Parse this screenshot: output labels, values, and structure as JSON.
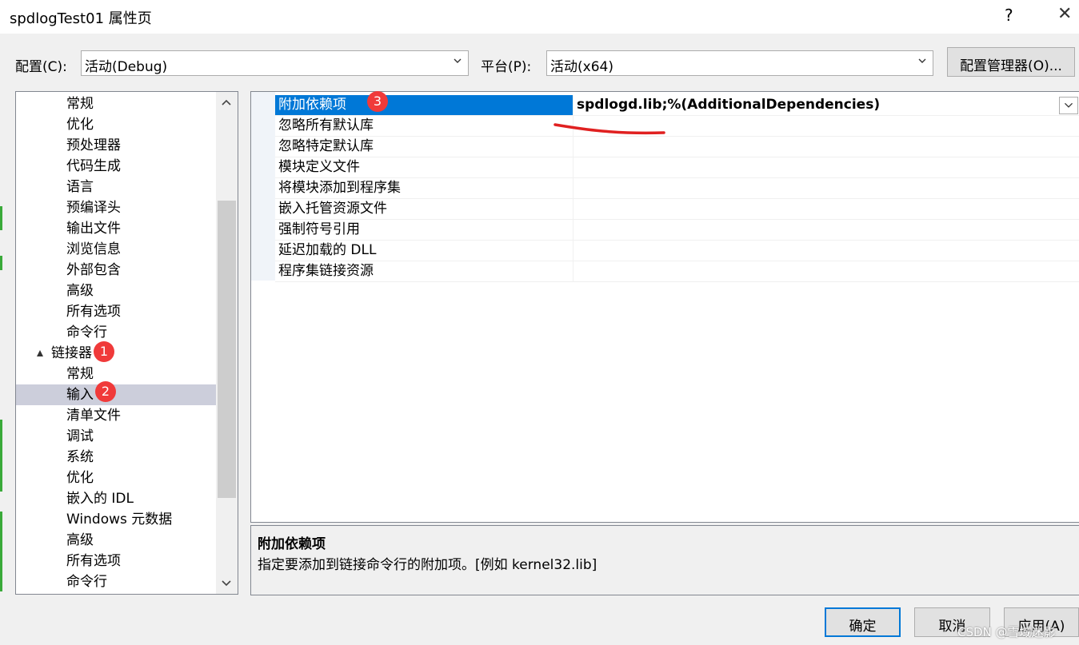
{
  "window": {
    "title": "spdlogTest01 属性页",
    "help_glyph": "?",
    "close_glyph": "✕"
  },
  "toolbar": {
    "config_label": "配置(C):",
    "config_value": "活动(Debug)",
    "platform_label": "平台(P):",
    "platform_value": "活动(x64)",
    "config_manager_label": "配置管理器(O)..."
  },
  "tree": {
    "items": [
      {
        "label": "常规",
        "level": 2
      },
      {
        "label": "优化",
        "level": 2
      },
      {
        "label": "预处理器",
        "level": 2
      },
      {
        "label": "代码生成",
        "level": 2
      },
      {
        "label": "语言",
        "level": 2
      },
      {
        "label": "预编译头",
        "level": 2
      },
      {
        "label": "输出文件",
        "level": 2
      },
      {
        "label": "浏览信息",
        "level": 2
      },
      {
        "label": "外部包含",
        "level": 2
      },
      {
        "label": "高级",
        "level": 2
      },
      {
        "label": "所有选项",
        "level": 2
      },
      {
        "label": "命令行",
        "level": 2
      },
      {
        "label": "链接器",
        "level": 1,
        "expanded": true
      },
      {
        "label": "常规",
        "level": 2
      },
      {
        "label": "输入",
        "level": 2,
        "selected": true
      },
      {
        "label": "清单文件",
        "level": 2
      },
      {
        "label": "调试",
        "level": 2
      },
      {
        "label": "系统",
        "level": 2
      },
      {
        "label": "优化",
        "level": 2
      },
      {
        "label": "嵌入的 IDL",
        "level": 2
      },
      {
        "label": "Windows 元数据",
        "level": 2
      },
      {
        "label": "高级",
        "level": 2
      },
      {
        "label": "所有选项",
        "level": 2
      },
      {
        "label": "命令行",
        "level": 2
      }
    ]
  },
  "properties": {
    "rows": [
      {
        "name": "附加依赖项",
        "value": "spdlogd.lib;%(AdditionalDependencies)",
        "selected": true
      },
      {
        "name": "忽略所有默认库",
        "value": ""
      },
      {
        "name": "忽略特定默认库",
        "value": ""
      },
      {
        "name": "模块定义文件",
        "value": ""
      },
      {
        "name": "将模块添加到程序集",
        "value": ""
      },
      {
        "name": "嵌入托管资源文件",
        "value": ""
      },
      {
        "name": "强制符号引用",
        "value": ""
      },
      {
        "name": "延迟加载的 DLL",
        "value": ""
      },
      {
        "name": "程序集链接资源",
        "value": ""
      }
    ]
  },
  "description": {
    "title": "附加依赖项",
    "text": "指定要添加到链接命令行的附加项。[例如 kernel32.lib]"
  },
  "buttons": {
    "ok": "确定",
    "cancel": "取消",
    "apply": "应用(A)"
  },
  "annotations": {
    "badge1": "1",
    "badge2": "2",
    "badge3": "3",
    "underline_color": "#e02020"
  },
  "watermark": "CSDN @雪域迷影",
  "colors": {
    "selection_blue": "#0078d7",
    "tree_selection": "#cccedb",
    "badge_red": "#f03a3a"
  }
}
